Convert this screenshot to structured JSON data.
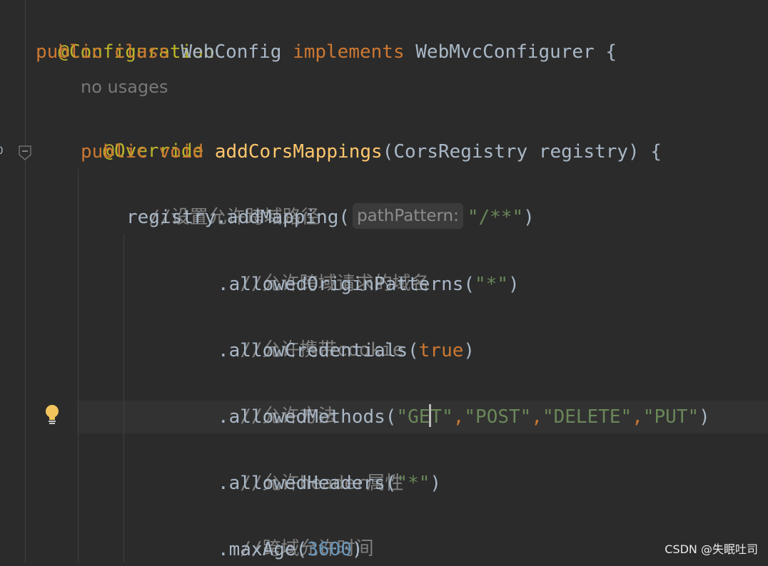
{
  "editor": {
    "usage_hint": "no usages",
    "param_hint": "pathPattern:",
    "lines": {
      "l1": {
        "ann": "@Configuration"
      },
      "l2": {
        "kw1": "public",
        "kw2": "class",
        "name": "WebConfig",
        "kw3": "implements",
        "iface": "WebMvcConfigurer",
        "brace": "{"
      },
      "l3": {
        "ann": "@Override"
      },
      "l4": {
        "kw1": "public",
        "kw2": "void",
        "method": "addCorsMappings",
        "params": "(CorsRegistry registry) {"
      },
      "l5": {
        "comment": "//设置允许跨域路径"
      },
      "l6": {
        "call": "registry.addMapping(",
        "str": "\"/**\"",
        "close": ")"
      },
      "l7": {
        "comment": "//允许跨域请求的域名"
      },
      "l8": {
        "call": ".allowedOriginPatterns(",
        "str": "\"*\"",
        "close": ")"
      },
      "l9": {
        "comment": "//允许携带cookie"
      },
      "l10": {
        "call": ".allowCredentials(",
        "kw": "true",
        "close": ")"
      },
      "l11": {
        "comment": "//允许方法"
      },
      "l12": {
        "call": ".allowedMethods(",
        "s1a": "\"GE",
        "s1b": "T\"",
        "c1": ",",
        "s2": "\"POST\"",
        "c2": ",",
        "s3": "\"DELETE\"",
        "c3": ",",
        "s4": "\"PUT\"",
        "close": ")"
      },
      "l13": {
        "comment": "//允许header属性"
      },
      "l14": {
        "call": ".allowedHeaders(",
        "str": "\"*\"",
        "close": ")"
      },
      "l15": {
        "comment": "//跨域允许时间"
      },
      "l16": {
        "call": ".maxAge(",
        "num": "3600",
        "close": ")"
      }
    }
  },
  "watermark": "CSDN @失眠吐司"
}
